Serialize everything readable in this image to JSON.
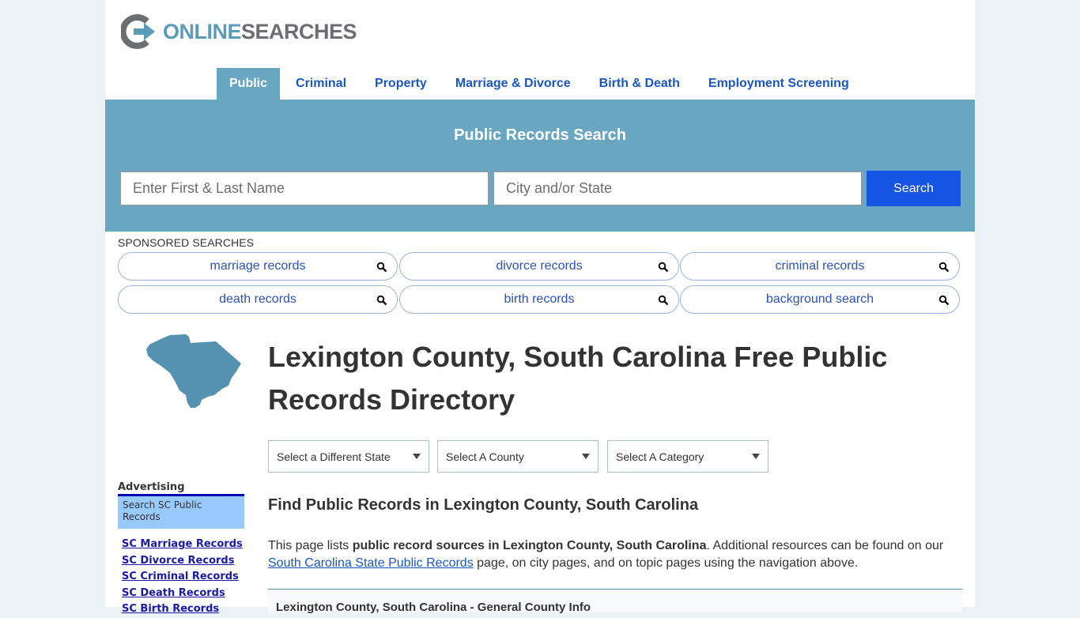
{
  "brand": {
    "logo_part1": "ONLINE",
    "logo_part2": "SEARCHES",
    "colors": {
      "accent": "#68a6c1",
      "button": "#1655e4",
      "link": "#1a56c2",
      "logo_gray": "#6d6e70",
      "logo_blue": "#5b9bb8"
    }
  },
  "nav": {
    "items": [
      {
        "label": "Public",
        "active": true
      },
      {
        "label": "Criminal",
        "active": false
      },
      {
        "label": "Property",
        "active": false
      },
      {
        "label": "Marriage & Divorce",
        "active": false
      },
      {
        "label": "Birth & Death",
        "active": false
      },
      {
        "label": "Employment Screening",
        "active": false
      }
    ]
  },
  "hero": {
    "title": "Public Records Search",
    "name_placeholder": "Enter First & Last Name",
    "location_placeholder": "City and/or State",
    "search_label": "Search"
  },
  "sponsored": {
    "label": "SPONSORED SEARCHES",
    "items": [
      {
        "label": "marriage records",
        "icon": "search-icon"
      },
      {
        "label": "divorce records",
        "icon": "search-icon"
      },
      {
        "label": "criminal records",
        "icon": "search-icon"
      },
      {
        "label": "death records",
        "icon": "search-icon"
      },
      {
        "label": "birth records",
        "icon": "search-icon"
      },
      {
        "label": "background search",
        "icon": "search-icon"
      }
    ]
  },
  "main": {
    "title": "Lexington County, South Carolina Free Public Records Directory",
    "selects": [
      {
        "value": "Select a Different State"
      },
      {
        "value": "Select A County"
      },
      {
        "value": "Select A Category"
      }
    ],
    "section_title": "Find Public Records in Lexington County, South Carolina",
    "intro": {
      "prefix": "This page lists ",
      "bold": "public record sources in Lexington County, South Carolina",
      "middle": ". Additional resources can be found on our ",
      "link": "South Carolina State Public Records",
      "suffix": " page, on city pages, and on topic pages using the navigation above."
    },
    "info_box_title": "Lexington County, South Carolina - General County Info"
  },
  "sidebar": {
    "state_icon": "south-carolina-map",
    "advertising_label": "Advertising",
    "ad_box_text": "Search SC Public Records",
    "links": [
      "SC Marriage Records",
      "SC Divorce Records",
      "SC Criminal Records",
      "SC Death Records",
      "SC Birth Records"
    ]
  }
}
